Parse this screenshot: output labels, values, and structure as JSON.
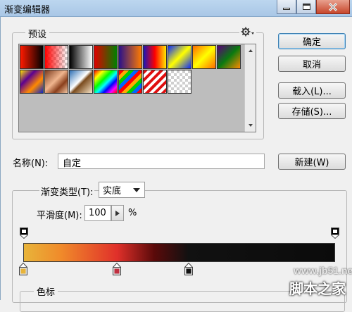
{
  "window": {
    "title": "渐变编辑器"
  },
  "icons": {
    "minimize": "minimize-icon",
    "maximize": "maximize-icon",
    "close": "close-icon",
    "menu": "gear-icon"
  },
  "presets": {
    "legend": "预设",
    "swatches": [
      {
        "name": "foreground-to-background",
        "css": "linear-gradient(90deg,#ff1a00,#000)"
      },
      {
        "name": "foreground-to-transparent",
        "css": "linear-gradient(90deg,#ff0000,rgba(255,0,0,0)),repeating-conic-gradient(#ccc 0 25%,#fff 0 50%) 0 0/8px 8px"
      },
      {
        "name": "black-white",
        "css": "linear-gradient(90deg,#000,#fff)"
      },
      {
        "name": "red-green",
        "css": "linear-gradient(90deg,#e00000,#008000)"
      },
      {
        "name": "violet-orange",
        "css": "linear-gradient(90deg,#29118a,#ff7b00)"
      },
      {
        "name": "blue-red-yellow",
        "css": "linear-gradient(90deg,#1b15b8,#ff0000 50%,#ffea00)"
      },
      {
        "name": "blue-yellow-blue",
        "css": "linear-gradient(135deg,#0a2aff,#ffff00 50%,#0a2aff)"
      },
      {
        "name": "orange-yellow-orange",
        "css": "linear-gradient(135deg,#ff6a00,#ffff00 50%,#ff6a00)"
      },
      {
        "name": "violet-green-orange",
        "css": "linear-gradient(135deg,#5a007a,#0a7a10 50%,#ff8a00)"
      },
      {
        "name": "yellow-violet-orange-blue",
        "css": "linear-gradient(135deg,#ffe400,#5c0091 33%,#ff8a00 66%,#0b25c7)"
      },
      {
        "name": "copper",
        "css": "linear-gradient(135deg,#7a3b1e,#f0b58e 45%,#8a3f1c 70%,#f5c9a6)"
      },
      {
        "name": "chrome",
        "css": "linear-gradient(135deg,#2d6fb4,#ffffff 45%,#7a4b1d 55%,#f6e4c8)"
      },
      {
        "name": "spectrum",
        "css": "linear-gradient(135deg,#ff0000,#ffff00 20%,#00ff00 40%,#00ffff 55%,#0000ff 70%,#ff00ff 85%,#ff0000)"
      },
      {
        "name": "transparent-rainbow",
        "css": "repeating-linear-gradient(135deg,#ff0000 0 5px,#ffaa00 5px 10px,#00cc00 10px 15px,#0066ff 15px 20px)"
      },
      {
        "name": "transparent-stripes",
        "css": "repeating-linear-gradient(135deg,#e01010 0 4px,#ffffff 4px 8px)"
      },
      {
        "name": "neutral-density",
        "css": "repeating-conic-gradient(#cfcfcf 0 25%,#ffffff 0 50%) 0 0/8px 8px"
      }
    ]
  },
  "buttons": {
    "ok": "确定",
    "cancel": "取消",
    "load": "载入(L)...",
    "save": "存储(S)...",
    "new": "新建(W)"
  },
  "name_field": {
    "label": "名称(N):",
    "value": "自定"
  },
  "gradient_type": {
    "label": "渐变类型(T):",
    "value": "实底"
  },
  "smoothness": {
    "label": "平滑度(M):",
    "value": "100",
    "unit": "%"
  },
  "stops_group": {
    "legend": "色标"
  },
  "gradient": {
    "colors": [
      "#e8b43a",
      "#f08a2a",
      "#e0302a",
      "#5a0a0a",
      "#111111",
      "#0b0b0b"
    ],
    "color_stops": [
      {
        "location_pct": 0,
        "color": "#e8b43a"
      },
      {
        "location_pct": 30,
        "color": "#c03040"
      },
      {
        "location_pct": 53,
        "color": "#111111"
      }
    ]
  },
  "watermark": {
    "line1": "www.jb51.net",
    "line2": "脚本之家"
  }
}
